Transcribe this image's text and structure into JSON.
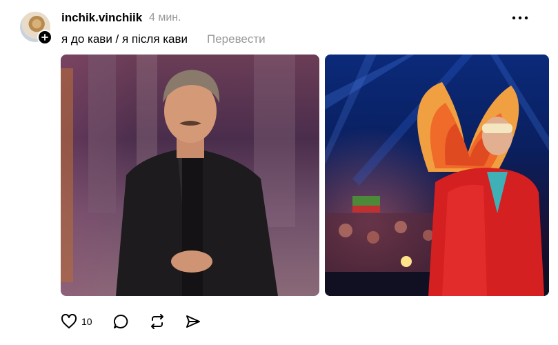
{
  "post": {
    "username": "inchik.vinchiik",
    "time": "4 мин.",
    "caption": "я до кави / я після кави",
    "translate_label": "Перевести",
    "like_count": "10"
  },
  "photos": [
    {
      "name": "photo-before-coffee"
    },
    {
      "name": "photo-after-coffee"
    }
  ],
  "icons": {
    "avatar_badge": "plus-icon",
    "more": "more-horizontal-icon",
    "like": "heart-icon",
    "comment": "comment-icon",
    "repost": "repost-icon",
    "share": "share-icon"
  }
}
